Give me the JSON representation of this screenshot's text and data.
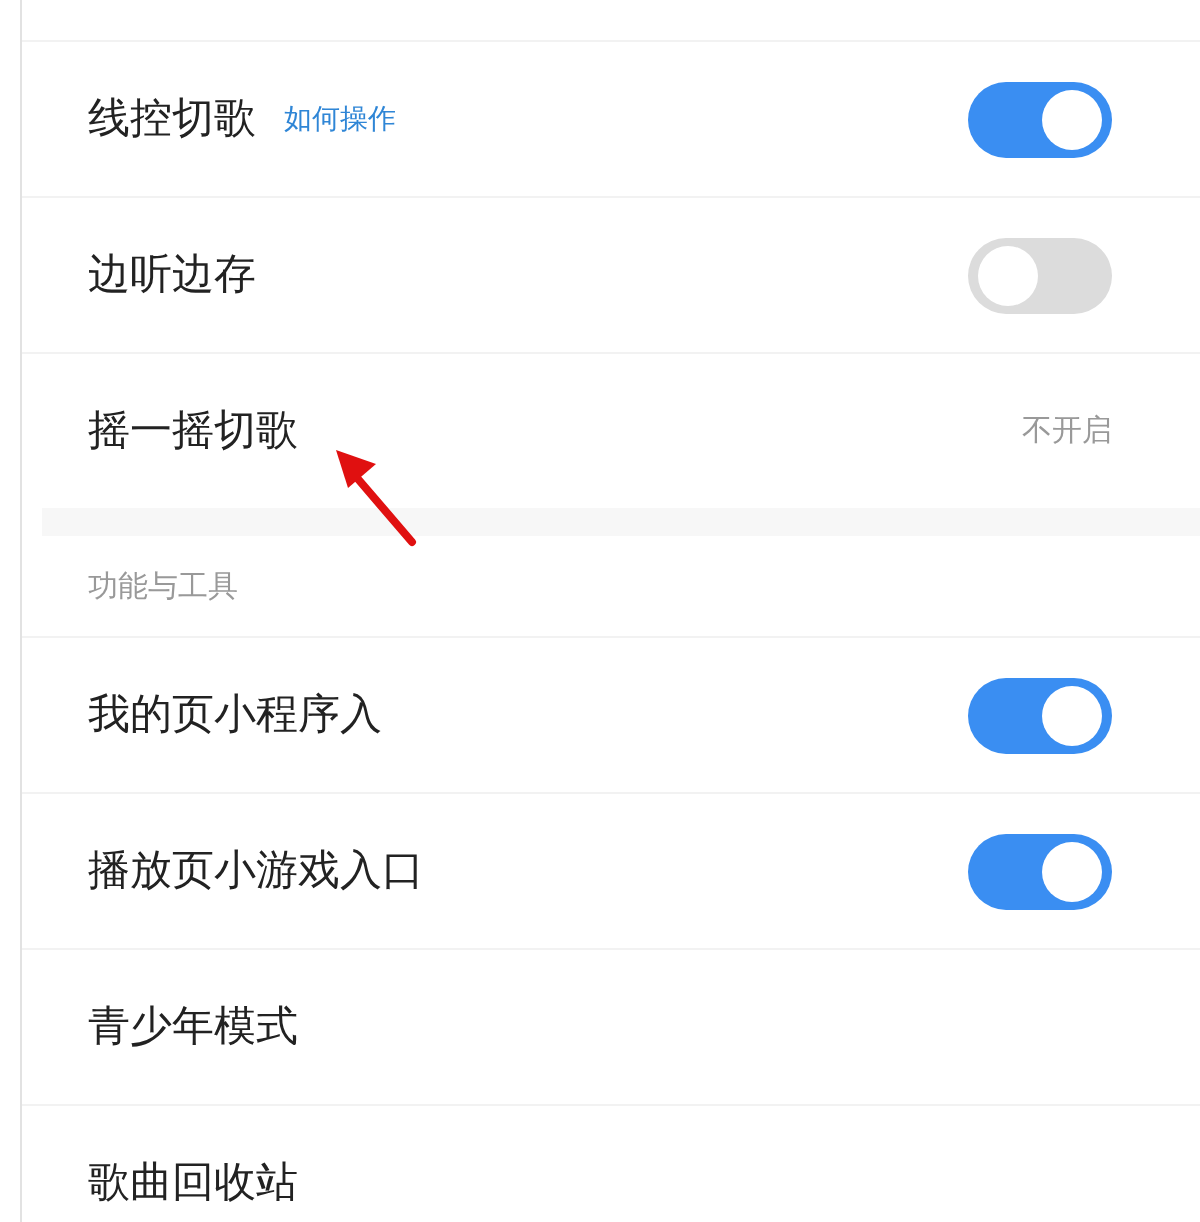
{
  "groups": [
    {
      "items": [
        {
          "kind": "toggle",
          "label": "线控切歌",
          "link": "如何操作",
          "on": true
        },
        {
          "kind": "toggle",
          "label": "边听边存",
          "on": false
        },
        {
          "kind": "value",
          "label": "摇一摇切歌",
          "value": "不开启"
        }
      ]
    },
    {
      "header": "功能与工具",
      "items": [
        {
          "kind": "toggle",
          "label": "我的页小程序入",
          "on": true
        },
        {
          "kind": "toggle",
          "label": "播放页小游戏入口",
          "on": true
        },
        {
          "kind": "plain",
          "label": "青少年模式"
        },
        {
          "kind": "plain",
          "label": "歌曲回收站"
        }
      ]
    }
  ]
}
